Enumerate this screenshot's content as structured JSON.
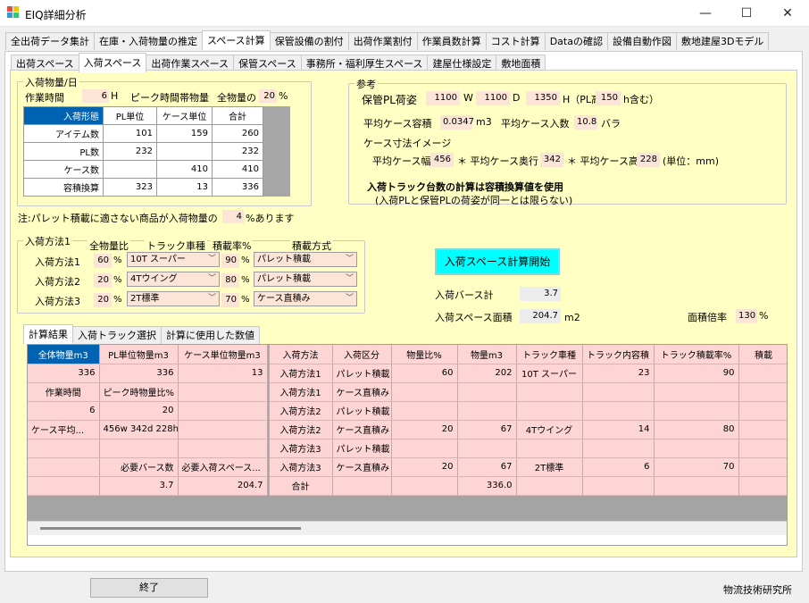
{
  "window": {
    "title": "EIQ詳細分析",
    "minimize": "—",
    "maximize": "☐",
    "close": "✕"
  },
  "main_tabs": [
    "全出荷データ集計",
    "在庫・入荷物量の推定",
    "スペース計算",
    "保管設備の割付",
    "出荷作業割付",
    "作業員数計算",
    "コスト計算",
    "Dataの確認",
    "設備自動作図",
    "敷地建屋3Dモデル"
  ],
  "sub_tabs": [
    "出荷スペース",
    "入荷スペース",
    "出荷作業スペース",
    "保管スペース",
    "事務所・福利厚生スペース",
    "建屋仕様設定",
    "敷地面積"
  ],
  "volume": {
    "title": "入荷物量/日",
    "work_time_label": "作業時間",
    "work_time": "6",
    "hour_unit": "H",
    "peak_label": "ピーク時間帯物量",
    "total_label": "全物量の",
    "peak_pct": "20",
    "pct_unit": "%",
    "table": {
      "headers": [
        "入荷形態",
        "PL単位",
        "ケース単位",
        "合計"
      ],
      "rows": [
        [
          "アイテム数",
          "101",
          "159",
          "260"
        ],
        [
          "PL数",
          "232",
          "",
          "232"
        ],
        [
          "ケース数",
          "",
          "410",
          "410"
        ],
        [
          "容積換算",
          "323",
          "13",
          "336"
        ]
      ]
    },
    "note_prefix": "注:パレット積載に適さない商品が入荷物量の",
    "note_value": "4",
    "note_suffix": "%あります"
  },
  "reference": {
    "title": "参考",
    "pl_label": "保管PL荷姿",
    "w": "1100",
    "w_unit": "W",
    "d": "1100",
    "d_unit": "D",
    "h": "1350",
    "h_unit": "H（PL高",
    "pl_h": "150",
    "pl_h_unit": "h含む）",
    "avg_vol_label": "平均ケース容積",
    "avg_vol": "0.0347",
    "avg_vol_unit": "m3",
    "avg_qty_label": "平均ケース入数",
    "avg_qty": "10.8",
    "avg_qty_unit": "バラ",
    "case_image_label": "ケース寸法イメージ",
    "cw_label": "平均ケース幅",
    "cw": "456",
    "cd_label": "＊ 平均ケース奥行",
    "cd": "342",
    "ch_label": "＊ 平均ケース高",
    "ch": "228",
    "unit_note": "(単位：mm)",
    "truck_note1": "入荷トラック台数の計算は容積換算値を使用",
    "truck_note2": "(入荷PLと保管PLの荷姿が同一とは限らない)"
  },
  "method": {
    "title": "入荷方法1",
    "col_ratio": "全物量比",
    "col_truck": "トラック車種",
    "col_load": "積載率%",
    "col_style": "積載方式",
    "pct": "%",
    "rows": [
      {
        "label": "入荷方法1",
        "ratio": "60",
        "truck": "10T スーパー",
        "load": "90",
        "style": "パレット積載"
      },
      {
        "label": "入荷方法2",
        "ratio": "20",
        "truck": "4Tウイング",
        "load": "80",
        "style": "パレット積載"
      },
      {
        "label": "入荷方法3",
        "ratio": "20",
        "truck": "2T標準",
        "load": "70",
        "style": "ケース直積み"
      }
    ]
  },
  "calc": {
    "start_button": "入荷スペース計算開始",
    "berth_label": "入荷バース計",
    "berth": "3.7",
    "area_label": "入荷スペース面積",
    "area": "204.7",
    "area_unit": "m2",
    "ratio_label": "面積倍率",
    "ratio": "130",
    "ratio_unit": "%"
  },
  "result_tabs": [
    "計算結果",
    "入荷トラック選択",
    "計算に使用した数値"
  ],
  "results": {
    "headers": [
      "全体物量m3",
      "PL単位物量m3",
      "ケース単位物量m3",
      "入荷方法",
      "入荷区分",
      "物量比%",
      "物量m3",
      "トラック車種",
      "トラック内容積",
      "トラック積載率%",
      "積載"
    ],
    "rows": [
      [
        "336",
        "336",
        "13",
        "入荷方法1",
        "パレット積載",
        "60",
        "202",
        "10T スーパー",
        "23",
        "90",
        ""
      ],
      [
        "作業時間",
        "ピーク時物量比%",
        "",
        "入荷方法1",
        "ケース直積み",
        "",
        "",
        "",
        "",
        "",
        ""
      ],
      [
        "6",
        "20",
        "",
        "入荷方法2",
        "パレット積載",
        "",
        "",
        "",
        "",
        "",
        ""
      ],
      [
        "ケース平均...",
        "456w 342d 228h",
        "",
        "入荷方法2",
        "ケース直積み",
        "20",
        "67",
        "4Tウイング",
        "14",
        "80",
        ""
      ],
      [
        "",
        "",
        "",
        "入荷方法3",
        "パレット積載",
        "",
        "",
        "",
        "",
        "",
        ""
      ],
      [
        "",
        "必要バース数",
        "必要入荷スペース...",
        "入荷方法3",
        "ケース直積み",
        "20",
        "67",
        "2T標準",
        "6",
        "70",
        ""
      ],
      [
        "",
        "3.7",
        "204.7",
        "合計",
        "",
        "",
        "336.0",
        "",
        "",
        "",
        ""
      ]
    ]
  },
  "footer": {
    "end_button": "終了",
    "company": "物流技術研究所"
  }
}
